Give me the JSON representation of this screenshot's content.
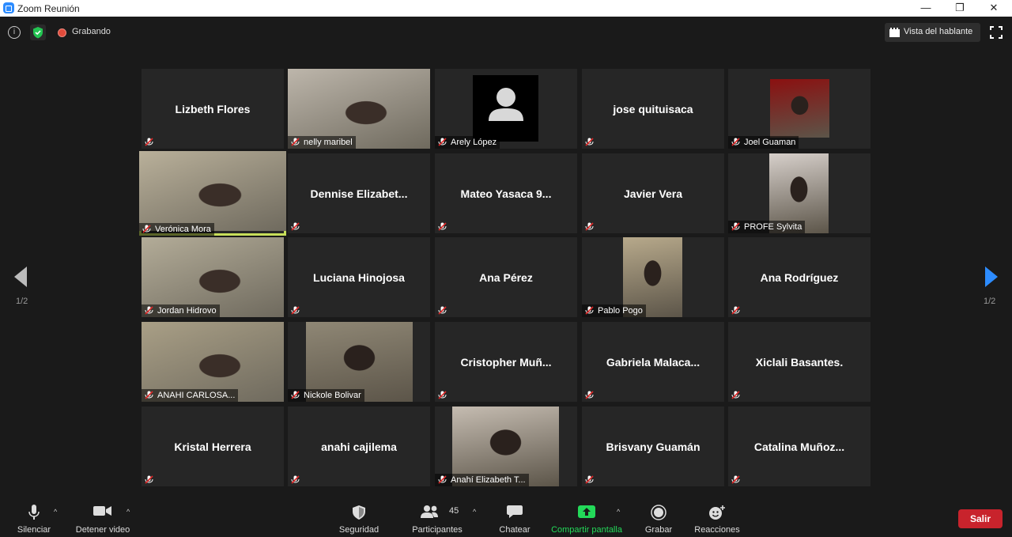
{
  "window": {
    "title": "Zoom Reunión",
    "minimize": "—",
    "restore": "❐",
    "close": "✕"
  },
  "topbar": {
    "recording_label": "Grabando",
    "view_label": "Vista del hablante"
  },
  "pagination": {
    "left": "1/2",
    "right": "1/2"
  },
  "participants": [
    {
      "name": "Lizbeth Flores",
      "mode": "name"
    },
    {
      "name": "nelly maribel",
      "mode": "video",
      "video_tone": "#bdb6ab"
    },
    {
      "name": "Arely López",
      "mode": "avatar"
    },
    {
      "name": "jose quituisaca",
      "mode": "name"
    },
    {
      "name": "Joel Guaman",
      "mode": "image",
      "video_tone": "#8b1010"
    },
    {
      "name": "Verónica Mora",
      "mode": "video",
      "video_tone": "#b9b09a",
      "active": true
    },
    {
      "name": "Dennise  Elizabet...",
      "mode": "name"
    },
    {
      "name": "Mateo Yasaca 9...",
      "mode": "name"
    },
    {
      "name": "Javier Vera",
      "mode": "name"
    },
    {
      "name": "PROFE Sylvita",
      "mode": "image",
      "video_tone": "#d6cfca"
    },
    {
      "name": "Jordan Hidrovo",
      "mode": "video",
      "video_tone": "#b3ac98"
    },
    {
      "name": "Luciana Hinojosa",
      "mode": "name"
    },
    {
      "name": "Ana Pérez",
      "mode": "name"
    },
    {
      "name": "Pablo Pogo",
      "mode": "image",
      "video_tone": "#b7a98b"
    },
    {
      "name": "Ana Rodríguez",
      "mode": "name"
    },
    {
      "name": "ANAHI CARLOSA...",
      "mode": "video",
      "video_tone": "#a99f86"
    },
    {
      "name": "Nickole Bolivar",
      "mode": "image",
      "video_tone": "#8f8775"
    },
    {
      "name": "Cristopher    Muñ...",
      "mode": "name"
    },
    {
      "name": "Gabriela  Malaca...",
      "mode": "name"
    },
    {
      "name": "Xiclali Basantes.",
      "mode": "name"
    },
    {
      "name": "Kristal Herrera",
      "mode": "name"
    },
    {
      "name": "anahi cajilema",
      "mode": "name"
    },
    {
      "name": "Anahí Elizabeth T...",
      "mode": "image",
      "video_tone": "#c5bcb1"
    },
    {
      "name": "Brisvany Guamán",
      "mode": "name"
    },
    {
      "name": "Catalina  Muñoz...",
      "mode": "name"
    }
  ],
  "toolbar": {
    "mute": "Silenciar",
    "video": "Detener video",
    "security": "Seguridad",
    "participants": "Participantes",
    "participants_count": "45",
    "chat": "Chatear",
    "share": "Compartir pantalla",
    "record": "Grabar",
    "reactions": "Reacciones",
    "leave": "Salir"
  },
  "colors": {
    "accent_green": "#23d959",
    "leave_red": "#c8232c",
    "active_border": "#c7de5a",
    "nav_blue": "#2d8cff"
  }
}
